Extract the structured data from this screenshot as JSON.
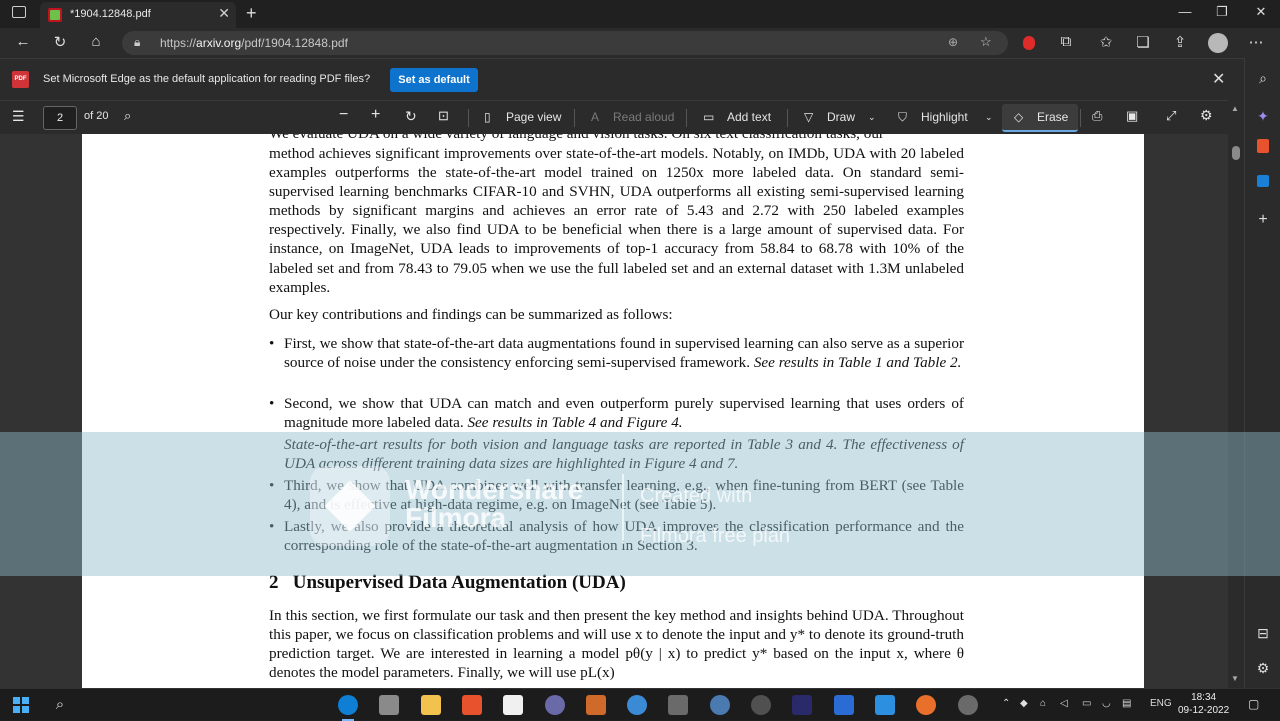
{
  "browser": {
    "tab_title": "*1904.12848.pdf",
    "tab_close": "✕",
    "new_tab": "+",
    "url_prefix": "https://",
    "url_host": "arxiv.org",
    "url_path": "/pdf/1904.12848.pdf",
    "window_controls": {
      "minimize": "—",
      "maximize": "❐",
      "close": "✕"
    }
  },
  "banner": {
    "message": "Set Microsoft Edge as the default application for reading PDF files?",
    "button_label": "Set as default",
    "close": "✕"
  },
  "pdf_toolbar": {
    "page_number": "2",
    "page_total": "of 20",
    "page_view": "Page view",
    "read_aloud": "Read aloud",
    "add_text": "Add text",
    "draw": "Draw",
    "highlight": "Highlight",
    "erase": "Erase"
  },
  "document": {
    "top_cut_line": "We evaluate UDA on a wide variety of language and vision tasks. On six text classification tasks, our",
    "paragraph1": "method achieves significant improvements over state-of-the-art models. Notably, on IMDb, UDA with 20 labeled examples outperforms the state-of-the-art model trained on 1250x more labeled data. On standard semi-supervised learning benchmarks CIFAR-10 and SVHN, UDA outperforms all existing semi-supervised learning methods by significant margins and achieves an error rate of 5.43 and 2.72 with 250 labeled examples respectively. Finally, we also find UDA to be beneficial when there is a large amount of supervised data. For instance, on ImageNet, UDA leads to improvements of top-1 accuracy from 58.84 to 68.78 with 10% of the labeled set and from 78.43 to 79.05 when we use the full labeled set and an external dataset with 1.3M unlabeled examples.",
    "paragraph2": "Our key contributions and findings can be summarized as follows:",
    "bullets": [
      {
        "text": "First, we show that state-of-the-art data augmentations found in supervised learning can also serve as a superior source of noise under the consistency enforcing semi-supervised framework.",
        "italic": "See results in Table 1 and Table 2."
      },
      {
        "text": "Second, we show that UDA can match and even outperform purely supervised learning that uses orders of magnitude more labeled data.",
        "italic": "See results in Table 4 and Figure 4."
      },
      {
        "text": "",
        "italic": "State-of-the-art results for both vision and language tasks are reported in Table 3 and 4. The effectiveness of UDA across different training data sizes are highlighted in Figure 4 and 7."
      },
      {
        "text": "Third, we show that UDA combines well with transfer learning, e.g., when fine-tuning from BERT (see Table 4), and is effective at high-data regime, e.g. on ImageNet (see Table 5).",
        "italic": ""
      },
      {
        "text": "Lastly, we also provide a theoretical analysis of how UDA improves the classification performance and the corresponding role of the state-of-the-art augmentation in Section 3.",
        "italic": ""
      }
    ],
    "section_number": "2",
    "section_title": "Unsupervised Data Augmentation (UDA)",
    "paragraph3": "In this section, we first formulate our task and then present the key method and insights behind UDA. Throughout this paper, we focus on classification problems and will use x to denote the input and y* to denote its ground-truth prediction target. We are interested in learning a model pθ(y | x) to predict y* based on the input x, where θ denotes the model parameters. Finally, we will use pL(x)"
  },
  "watermark": {
    "brand_line1": "Wondershare",
    "brand_line2": "Filmora",
    "sub_line1": "Created with",
    "sub_line2": "Filmora free plan"
  },
  "taskbar": {
    "time": "18:34",
    "date": "09-12-2022",
    "language": "ENG"
  },
  "colors": {
    "accent": "#0e73cc",
    "watermark_band": "#8ebacd",
    "pdf_icon": "#d13438"
  }
}
